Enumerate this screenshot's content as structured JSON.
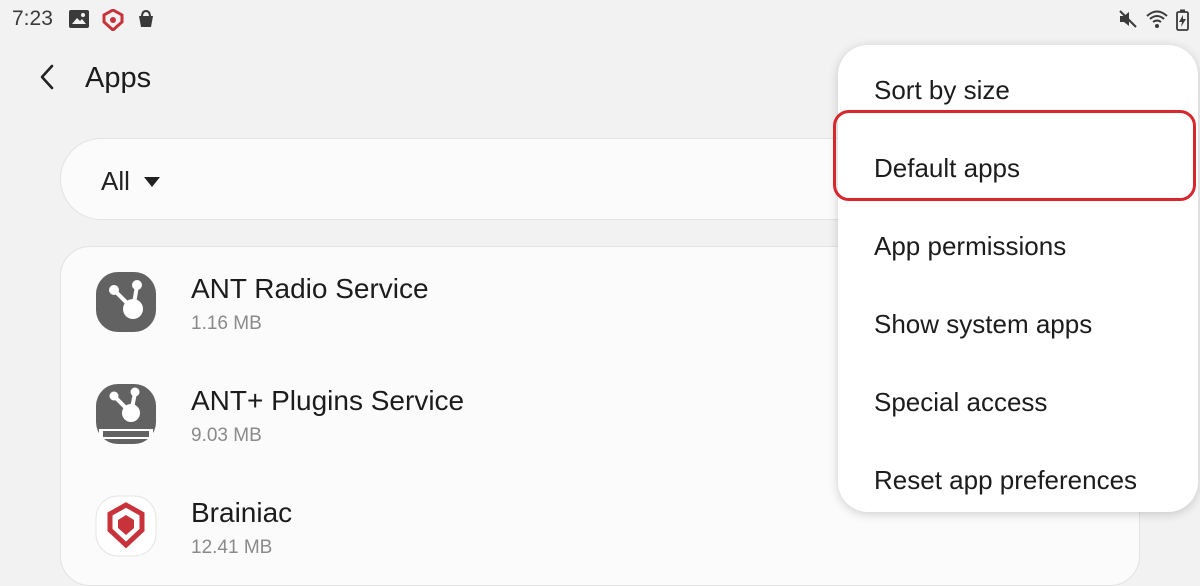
{
  "status_bar": {
    "time": "7:23",
    "icons": [
      "gallery-icon",
      "brainiac-shield-icon",
      "shopping-bag-icon",
      "mute-icon",
      "wifi-icon",
      "battery-charging-icon"
    ]
  },
  "header": {
    "title": "Apps",
    "back_icon": "back-arrow-icon"
  },
  "filter": {
    "label": "All"
  },
  "apps": [
    {
      "name": "ANT Radio Service",
      "size": "1.16 MB",
      "icon": "ant-radio-icon"
    },
    {
      "name": "ANT+ Plugins Service",
      "size": "9.03 MB",
      "icon": "ant-plugins-icon"
    },
    {
      "name": "Brainiac",
      "size": "12.41 MB",
      "icon": "brainiac-icon"
    }
  ],
  "menu": {
    "items": [
      {
        "label": "Sort by size"
      },
      {
        "label": "Default apps"
      },
      {
        "label": "App permissions"
      },
      {
        "label": "Show system apps"
      },
      {
        "label": "Special access"
      },
      {
        "label": "Reset app preferences"
      }
    ],
    "highlighted": "Default apps"
  },
  "colors": {
    "highlight": "#d7262c",
    "background": "#f2f2f2",
    "card": "#fbfbfb",
    "icon_gray": "#626262"
  }
}
